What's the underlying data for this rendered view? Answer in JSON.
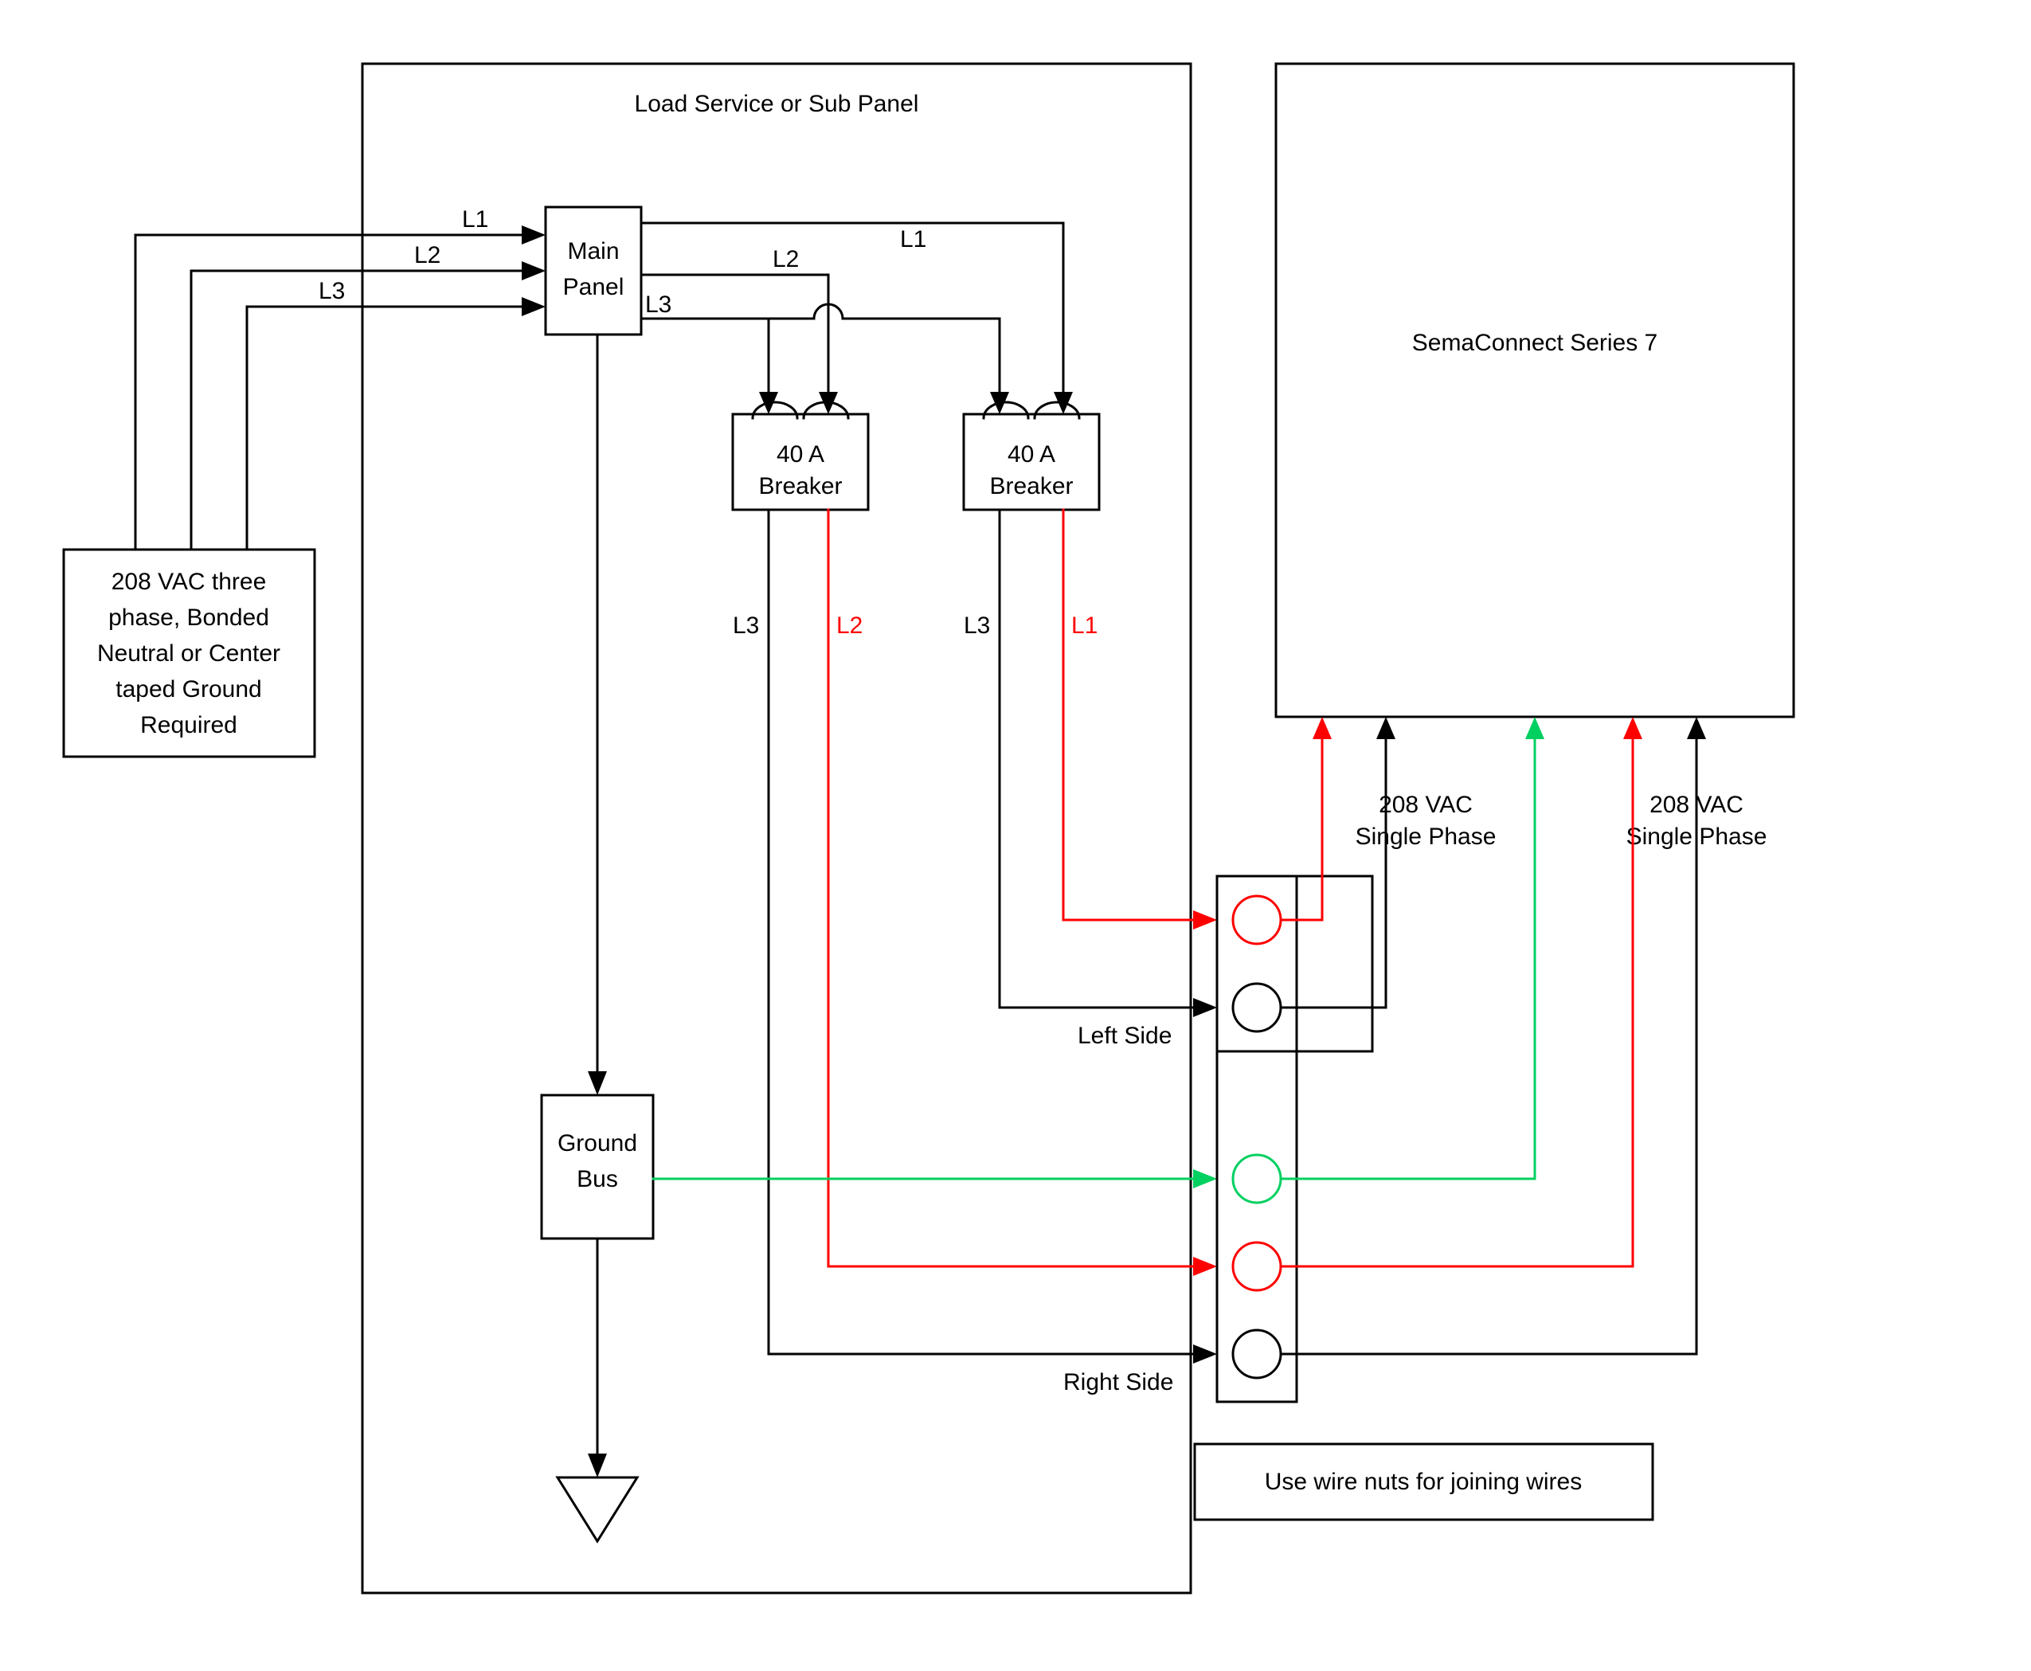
{
  "diagram": {
    "title": "Load Service or Sub Panel",
    "source": {
      "line1": "208 VAC three",
      "line2": "phase, Bonded",
      "line3": "Neutral or Center",
      "line4": "taped Ground",
      "line5": "Required"
    },
    "main_panel": {
      "line1": "Main",
      "line2": "Panel"
    },
    "breaker_left": {
      "line1": "40 A",
      "line2": "Breaker"
    },
    "breaker_right": {
      "line1": "40 A",
      "line2": "Breaker"
    },
    "ground_bus": {
      "line1": "Ground",
      "line2": "Bus"
    },
    "left_side": "Left Side",
    "right_side": "Right Side",
    "wire_nuts_note": "Use wire nuts for joining wires",
    "device": "SemaConnect Series 7",
    "vac_left": {
      "line1": "208 VAC",
      "line2": "Single Phase"
    },
    "vac_right": {
      "line1": "208 VAC",
      "line2": "Single Phase"
    },
    "labels": {
      "L1_in": "L1",
      "L2_in": "L2",
      "L3_in": "L3",
      "L1_top": "L1",
      "L2_top": "L2",
      "L3_top": "L3",
      "L3_bl": "L3",
      "L2_bl": "L2",
      "L3_br": "L3",
      "L1_br": "L1"
    },
    "colors": {
      "black": "#000000",
      "red": "#ff0000",
      "green": "#00d060"
    }
  }
}
